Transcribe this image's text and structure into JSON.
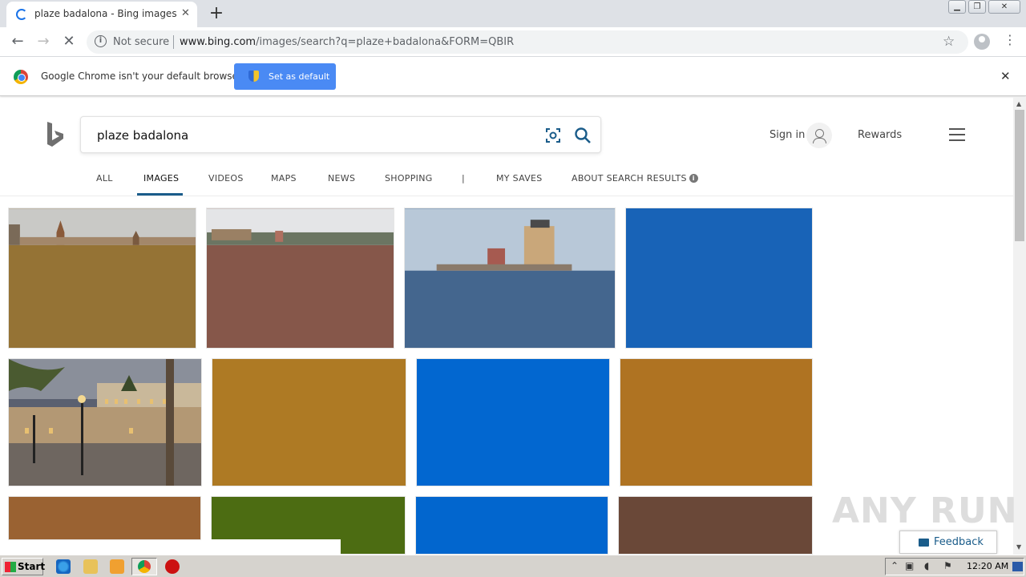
{
  "browser": {
    "tab_title": "plaze badalona - Bing images",
    "omnibox_security": "Not secure",
    "url_domain": "www.bing.com",
    "url_path": "/images/search?q=plaze+badalona&FORM=QBIR"
  },
  "infobar": {
    "message": "Google Chrome isn't your default browser",
    "button_label": "Set as default"
  },
  "bing": {
    "query": "plaze badalona",
    "signin_label": "Sign in",
    "rewards_label": "Rewards",
    "tabs": [
      {
        "label": "ALL"
      },
      {
        "label": "IMAGES"
      },
      {
        "label": "VIDEOS"
      },
      {
        "label": "MAPS"
      },
      {
        "label": "NEWS"
      },
      {
        "label": "SHOPPING"
      },
      {
        "label": "|"
      },
      {
        "label": "MY SAVES"
      },
      {
        "label": "ABOUT SEARCH RESULTS"
      }
    ],
    "feedback_label": "Feedback"
  },
  "colors": {
    "accent": "#1a5c8a",
    "chrome_blue": "#4a8af4",
    "tile_colors": [
      "#957335",
      "#86574a",
      "#44668e",
      "#1863b7",
      "#ae7a24",
      "#0267d0",
      "#af7322",
      "#9a6232",
      "#4c6c12",
      "#0266ce",
      "#6a4838"
    ]
  },
  "watermark": "ANY RUN",
  "taskbar": {
    "start_label": "Start",
    "clock": "12:20 AM"
  }
}
